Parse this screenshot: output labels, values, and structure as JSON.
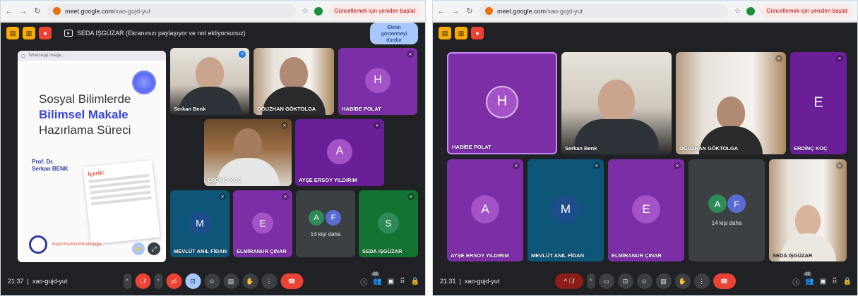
{
  "browser": {
    "url_host": "meet.google.com",
    "url_path": "/xao-gujd-yut",
    "update_label": "Güncellemek için yeniden başlat"
  },
  "left": {
    "share_banner": "SEDA IŞGÜZAR (Ekranınızı paylaşıyor ve not ekliyorsunuz)",
    "stop_share": "Ekran göstermeyi durdur",
    "presentation": {
      "tab_label": "WhatsApp Image...",
      "title_line1": "Sosyal Bilimlerde",
      "title_line2": "Bilimsel Makale",
      "title_line3": "Hazırlama Süreci",
      "author_prefix": "Prof. Dr.",
      "author_name": "Serkan BENK",
      "card_title": "İçerik:",
      "footer": "Araştırma Koordinatörlüğü"
    },
    "tiles": [
      {
        "name": "Serkan Benk"
      },
      {
        "name": "OĞUZHAN GÖKTOLGA"
      },
      {
        "name": "HABİBE POLAT",
        "initial": "H"
      },
      {
        "name": "ERDİNÇ KOÇ"
      },
      {
        "name": "AYŞE ERSOY YILDIRIM",
        "initial": "A"
      },
      {
        "name": "MEVLÜT ANIL FİDAN",
        "initial": "M"
      },
      {
        "name": "ELMİRANUR ÇINAR",
        "initial": "E"
      },
      {
        "more": "14 kişi daha",
        "initial_a": "A",
        "initial_b": "F"
      },
      {
        "name": "SEDA IŞGÜZAR",
        "initial": "S"
      }
    ],
    "time": "21:37",
    "meeting_code": "xao-gujd-yut",
    "participants_count": "22"
  },
  "right": {
    "tiles": [
      {
        "name": "HABİBE POLAT",
        "initial": "H"
      },
      {
        "name": "Serkan Benk"
      },
      {
        "name": "OĞUZHAN GÖKTOLGA"
      },
      {
        "name": "ERDİNÇ KOÇ",
        "initial": "E"
      },
      {
        "name": "AYŞE ERSOY YILDIRIM",
        "initial": "A"
      },
      {
        "name": "MEVLÜT ANIL FİDAN",
        "initial": "M"
      },
      {
        "name": "ELMİRANUR ÇINAR",
        "initial": "E"
      },
      {
        "more": "14 kişi daha",
        "initial_a": "A",
        "initial_b": "F"
      },
      {
        "name": "SEDA IŞGÜZAR"
      }
    ],
    "time": "21:31",
    "meeting_code": "xao-gujd-yut",
    "participants_count": "22"
  },
  "colors": {
    "meet_bg": "#202124",
    "tile_violet": "#7b2ea6",
    "tile_blue": "#0d5678",
    "hangup": "#ea4335"
  }
}
